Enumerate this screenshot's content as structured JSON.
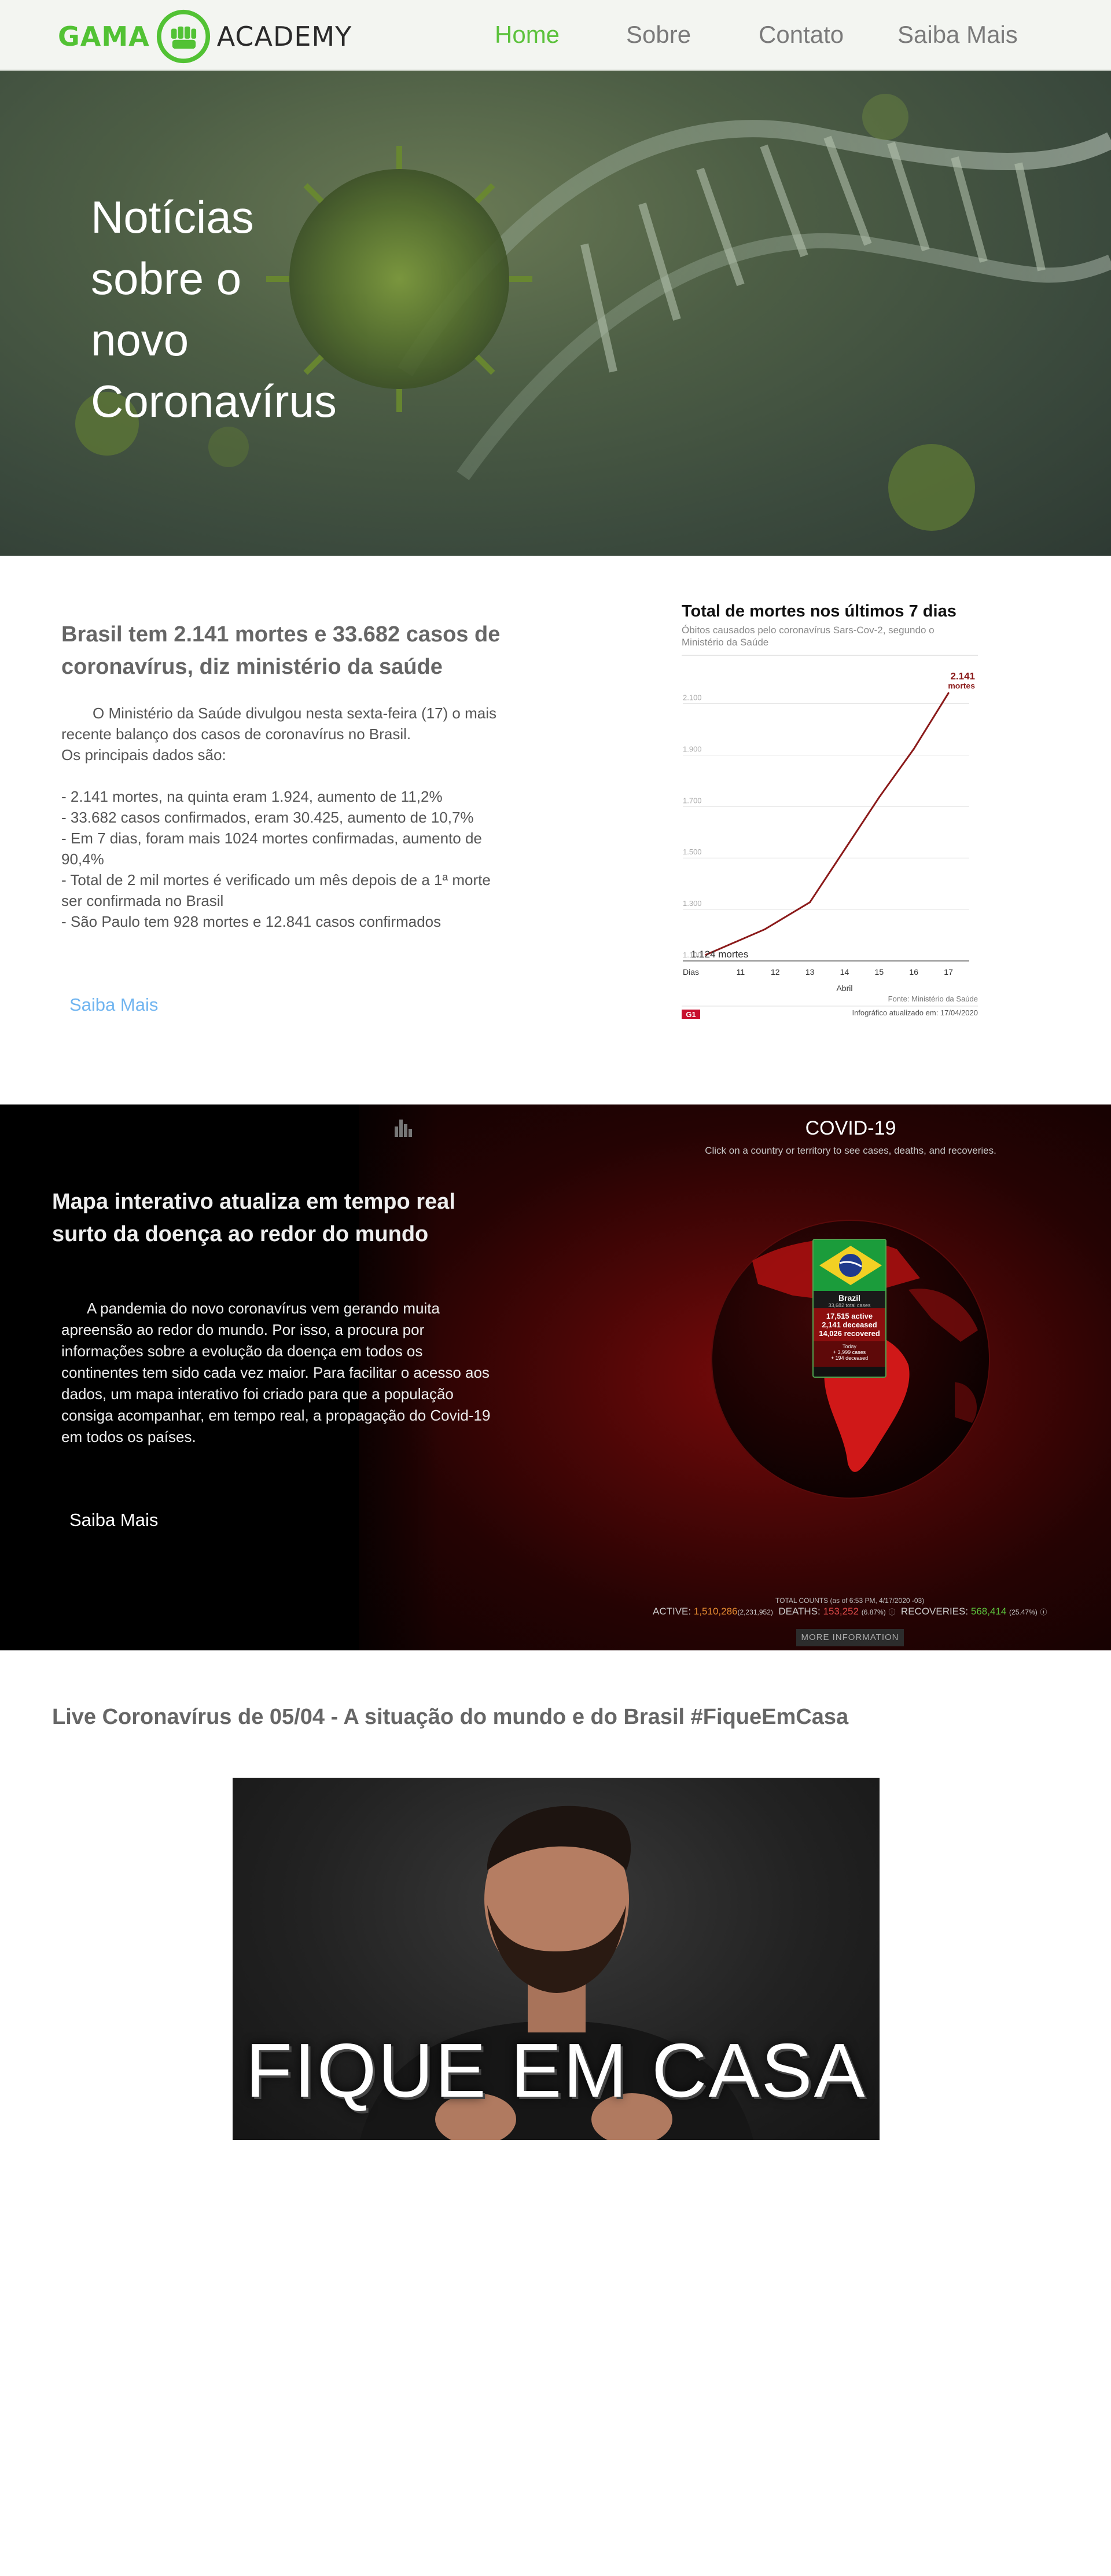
{
  "nav": {
    "logo_left": "GAMA",
    "logo_right": "ACADEMY",
    "links": [
      {
        "label": "Home",
        "active": true
      },
      {
        "label": "Sobre",
        "active": false
      },
      {
        "label": "Contato",
        "active": false
      },
      {
        "label": "Saiba Mais",
        "active": false
      }
    ]
  },
  "hero": {
    "title_lines": [
      "Notícias",
      "sobre o",
      "novo",
      "Coronavírus"
    ]
  },
  "news": {
    "heading": "Brasil tem 2.141 mortes e 33.682 casos de coronavírus, diz ministério da saúde",
    "intro": "O Ministério da Saúde divulgou nesta sexta-feira (17) o mais recente balanço dos casos de coronavírus no Brasil.",
    "lead": "Os principais dados são:",
    "bullets": [
      "- 2.141 mortes, na quinta eram 1.924, aumento de 11,2%",
      "- 33.682 casos confirmados, eram 30.425, aumento de 10,7%",
      "- Em 7 dias, foram mais 1024 mortes confirmadas, aumento de 90,4%",
      "- Total de 2 mil mortes é verificado um mês depois de a 1ª morte ser confirmada no Brasil",
      "- São Paulo tem 928 mortes e 12.841 casos confirmados"
    ],
    "link": "Saiba Mais"
  },
  "chart_data": {
    "type": "line",
    "title": "Total de mortes nos últimos 7 dias",
    "subtitle": "Óbitos causados pelo coronavírus Sars-Cov-2, segundo o Ministério da Saúde",
    "xlabel": "Abril",
    "x_prefix": "Dias",
    "x": [
      10,
      11,
      12,
      13,
      14,
      15,
      16,
      17
    ],
    "y": [
      1124,
      1223,
      1328,
      1532,
      1736,
      1924,
      2141
    ],
    "y_points_x": [
      10,
      11.7,
      13,
      14,
      15,
      16,
      17
    ],
    "yticks": [
      1100,
      1300,
      1500,
      1700,
      1900,
      2100
    ],
    "ylim": [
      1100,
      2180
    ],
    "start_label": "1.124 mortes",
    "end_label_value": "2.141",
    "end_label_unit": "mortes",
    "source": "Fonte: Ministério da Saúde",
    "updated": "Infográfico atualizado em: 17/04/2020",
    "brand": "G1",
    "grid": true,
    "line_color": "#8b1a1a"
  },
  "map": {
    "heading": "Mapa interativo atualiza em tempo real surto da doença ao redor do mundo",
    "body": "A pandemia do novo coronavírus vem gerando muita apreensão ao redor do mundo. Por isso, a procura por informações sobre a evolução da doença em todos os continentes tem sido cada vez maior. Para facilitar o acesso aos dados, um mapa interativo foi criado para que a população consiga acompanhar, em tempo real, a propagação do Covid-19 em todos os países.",
    "link": "Saiba Mais",
    "widget_title": "COVID-19",
    "widget_subtitle": "Click on a country or territory to see cases, deaths, and recoveries.",
    "popup_country": "Brazil",
    "popup_total": "33,682 total cases",
    "popup_active": "17,515 active",
    "popup_deceased": "2,141 deceased",
    "popup_recovered": "14,026 recovered",
    "popup_today": "Today",
    "popup_new_cases": "+ 3,999 cases",
    "popup_new_deaths": "+ 194 deceased",
    "counts_caption": "TOTAL COUNTS (as of 6:53 PM, 4/17/2020 -03)",
    "active_label": "ACTIVE:",
    "active_value": "1,510,286",
    "active_extra": "(2,231,952)",
    "deaths_label": "DEATHS:",
    "deaths_value": "153,252",
    "deaths_pct": "(6.87%)",
    "recoveries_label": "RECOVERIES:",
    "recoveries_value": "568,414",
    "recoveries_pct": "(25.47%)",
    "more_info": "MORE INFORMATION",
    "colors": {
      "active": "#e58a30",
      "deaths": "#e24a4a",
      "recoveries": "#5cc23c"
    }
  },
  "live": {
    "heading": "Live Coronavírus de 05/04 - A situação do mundo e do Brasil #FiqueEmCasa",
    "video_caption": "FIQUE EM CASA"
  },
  "colors": {
    "brand_green": "#5cc23c",
    "link_blue": "#6fb4f0"
  }
}
